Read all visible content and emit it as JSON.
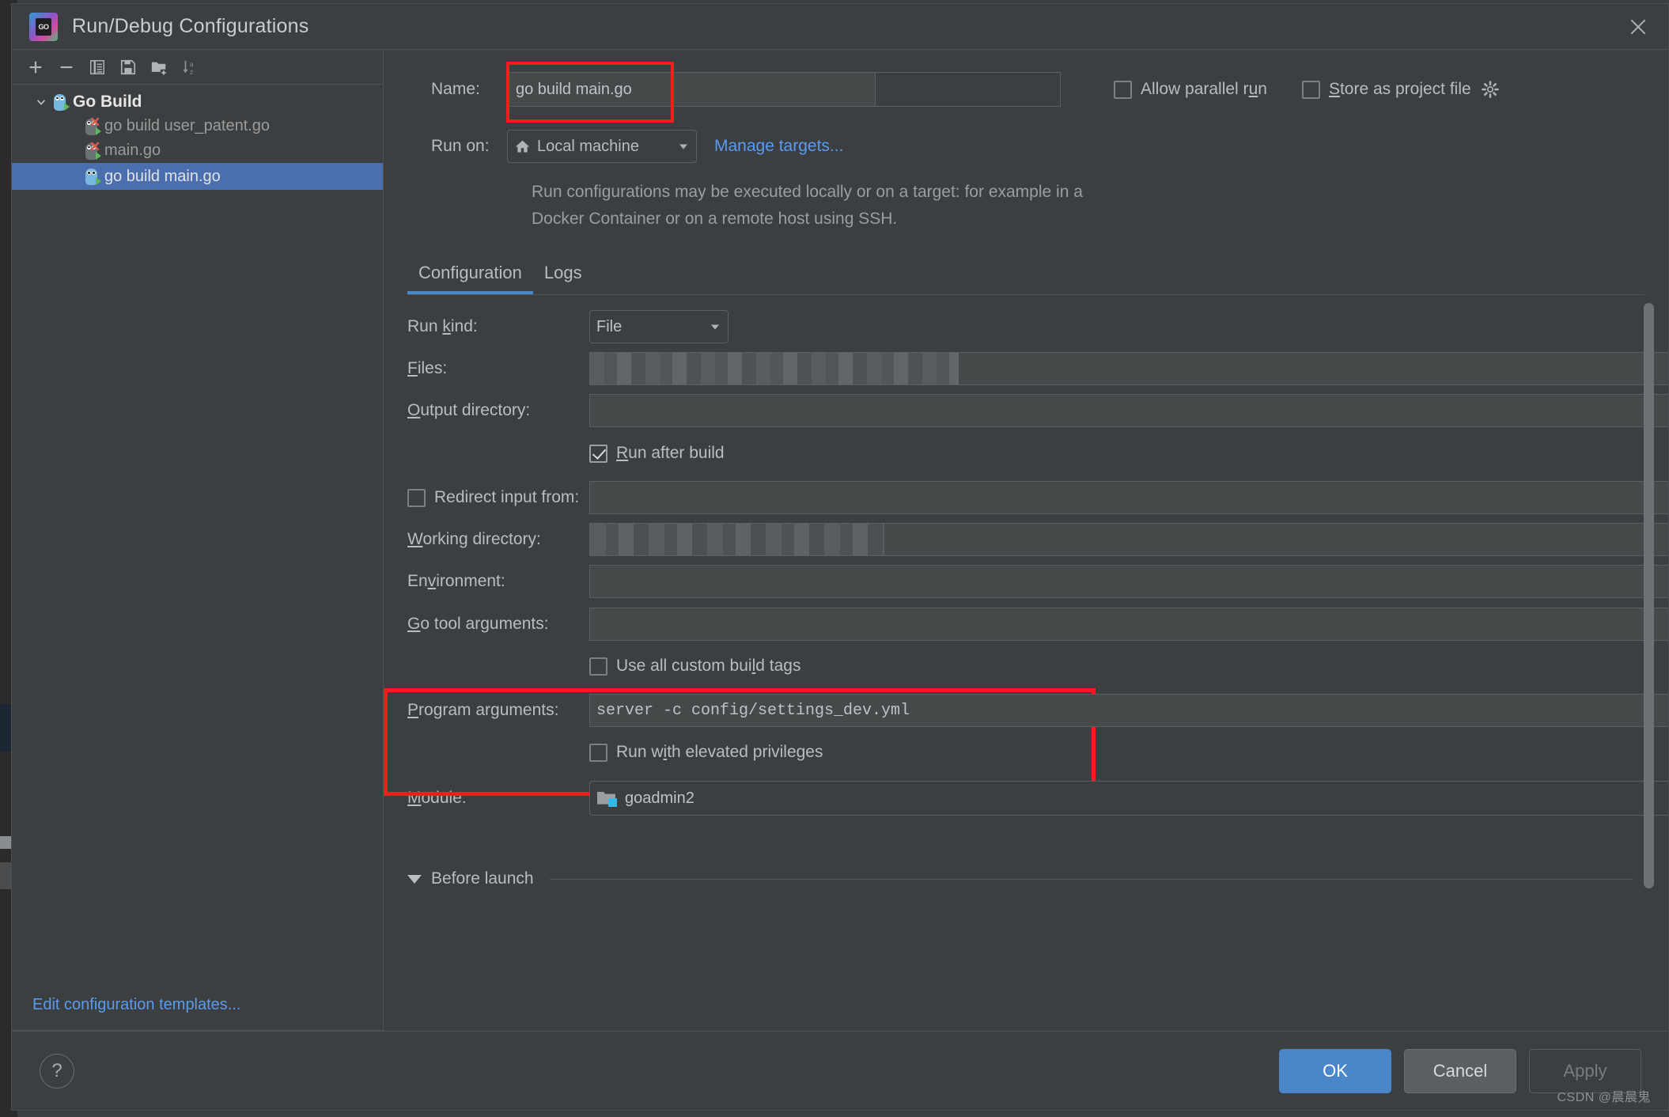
{
  "window": {
    "title": "Run/Debug Configurations",
    "logo_text": "GO",
    "close_icon": "close-icon"
  },
  "left_panel": {
    "toolbar": [
      {
        "name": "add-configuration-button",
        "icon": "plus-icon"
      },
      {
        "name": "remove-configuration-button",
        "icon": "minus-icon"
      },
      {
        "name": "copy-configuration-button",
        "icon": "copy-icon"
      },
      {
        "name": "save-configuration-button",
        "icon": "save-icon"
      },
      {
        "name": "move-to-folder-button",
        "icon": "folder-plus-icon"
      },
      {
        "name": "sort-configurations-button",
        "icon": "sort-az-icon"
      }
    ],
    "tree": [
      {
        "label": "Go Build",
        "type": "group",
        "expanded": true,
        "selected": false,
        "error": false
      },
      {
        "label": "go build user_patent.go",
        "type": "item",
        "selected": false,
        "error": true
      },
      {
        "label": "main.go",
        "type": "item",
        "selected": false,
        "error": true
      },
      {
        "label": "go build main.go",
        "type": "item",
        "selected": true,
        "error": false
      }
    ],
    "edit_templates_link": "Edit configuration templates..."
  },
  "header": {
    "name_label": "Name:",
    "name_value": "go build main.go",
    "allow_parallel_run_label": "Allow parallel run",
    "allow_parallel_run_checked": false,
    "store_as_project_file_label": "Store as project file",
    "store_as_project_file_checked": false,
    "gear_icon": "gear-icon",
    "run_on_label": "Run on:",
    "run_on_value": "Local machine",
    "manage_targets_link": "Manage targets...",
    "description": "Run configurations may be executed locally or on a target: for example in a Docker Container or on a remote host using SSH."
  },
  "tabs": [
    {
      "label": "Configuration",
      "active": true
    },
    {
      "label": "Logs",
      "active": false
    }
  ],
  "form": {
    "run_kind_label": "Run kind:",
    "run_kind_value": "File",
    "files_label": "Files:",
    "files_value": "",
    "output_directory_label": "Output directory:",
    "output_directory_value": "",
    "run_after_build_label": "Run after build",
    "run_after_build_checked": true,
    "redirect_input_label": "Redirect input from:",
    "redirect_input_checked": false,
    "redirect_input_value": "",
    "working_directory_label": "Working directory:",
    "working_directory_value": "",
    "environment_label": "Environment:",
    "environment_value": "",
    "go_tool_arguments_label": "Go tool arguments:",
    "go_tool_arguments_value": "",
    "use_all_custom_build_tags_label": "Use all custom build tags",
    "use_all_custom_build_tags_checked": false,
    "program_arguments_label": "Program arguments:",
    "program_arguments_value": "server -c  config/settings_dev.yml",
    "run_with_elevated_privileges_label": "Run with elevated privileges",
    "run_with_elevated_privileges_checked": false,
    "module_label": "Module:",
    "module_value": "goadmin2",
    "before_launch_label": "Before launch"
  },
  "footer": {
    "help_label": "?",
    "ok_label": "OK",
    "cancel_label": "Cancel",
    "apply_label": "Apply",
    "apply_enabled": false
  },
  "watermark": "CSDN @晨晨鬼",
  "colors": {
    "accent": "#4a86c8",
    "link": "#5a9bf0",
    "selection": "#4b6eaf",
    "highlight_box": "#f71b1b",
    "window_bg": "#3c3f41",
    "input_bg": "#45494a"
  }
}
